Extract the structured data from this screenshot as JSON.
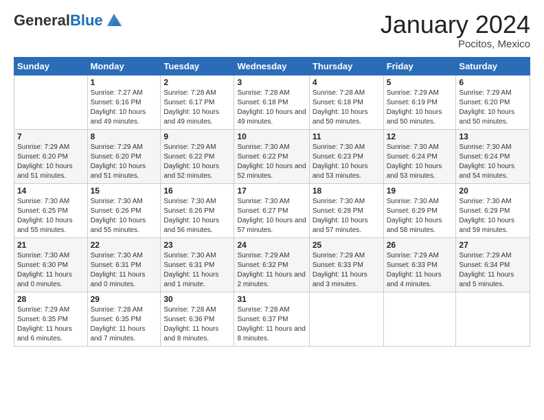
{
  "header": {
    "logo_general": "General",
    "logo_blue": "Blue",
    "month_title": "January 2024",
    "location": "Pocitos, Mexico"
  },
  "weekdays": [
    "Sunday",
    "Monday",
    "Tuesday",
    "Wednesday",
    "Thursday",
    "Friday",
    "Saturday"
  ],
  "weeks": [
    [
      {
        "day": "",
        "sunrise": "",
        "sunset": "",
        "daylight": ""
      },
      {
        "day": "1",
        "sunrise": "Sunrise: 7:27 AM",
        "sunset": "Sunset: 6:16 PM",
        "daylight": "Daylight: 10 hours and 49 minutes."
      },
      {
        "day": "2",
        "sunrise": "Sunrise: 7:28 AM",
        "sunset": "Sunset: 6:17 PM",
        "daylight": "Daylight: 10 hours and 49 minutes."
      },
      {
        "day": "3",
        "sunrise": "Sunrise: 7:28 AM",
        "sunset": "Sunset: 6:18 PM",
        "daylight": "Daylight: 10 hours and 49 minutes."
      },
      {
        "day": "4",
        "sunrise": "Sunrise: 7:28 AM",
        "sunset": "Sunset: 6:18 PM",
        "daylight": "Daylight: 10 hours and 50 minutes."
      },
      {
        "day": "5",
        "sunrise": "Sunrise: 7:29 AM",
        "sunset": "Sunset: 6:19 PM",
        "daylight": "Daylight: 10 hours and 50 minutes."
      },
      {
        "day": "6",
        "sunrise": "Sunrise: 7:29 AM",
        "sunset": "Sunset: 6:20 PM",
        "daylight": "Daylight: 10 hours and 50 minutes."
      }
    ],
    [
      {
        "day": "7",
        "sunrise": "Sunrise: 7:29 AM",
        "sunset": "Sunset: 6:20 PM",
        "daylight": "Daylight: 10 hours and 51 minutes."
      },
      {
        "day": "8",
        "sunrise": "Sunrise: 7:29 AM",
        "sunset": "Sunset: 6:20 PM",
        "daylight": "Daylight: 10 hours and 51 minutes."
      },
      {
        "day": "9",
        "sunrise": "Sunrise: 7:29 AM",
        "sunset": "Sunset: 6:22 PM",
        "daylight": "Daylight: 10 hours and 52 minutes."
      },
      {
        "day": "10",
        "sunrise": "Sunrise: 7:30 AM",
        "sunset": "Sunset: 6:22 PM",
        "daylight": "Daylight: 10 hours and 52 minutes."
      },
      {
        "day": "11",
        "sunrise": "Sunrise: 7:30 AM",
        "sunset": "Sunset: 6:23 PM",
        "daylight": "Daylight: 10 hours and 53 minutes."
      },
      {
        "day": "12",
        "sunrise": "Sunrise: 7:30 AM",
        "sunset": "Sunset: 6:24 PM",
        "daylight": "Daylight: 10 hours and 53 minutes."
      },
      {
        "day": "13",
        "sunrise": "Sunrise: 7:30 AM",
        "sunset": "Sunset: 6:24 PM",
        "daylight": "Daylight: 10 hours and 54 minutes."
      }
    ],
    [
      {
        "day": "14",
        "sunrise": "Sunrise: 7:30 AM",
        "sunset": "Sunset: 6:25 PM",
        "daylight": "Daylight: 10 hours and 55 minutes."
      },
      {
        "day": "15",
        "sunrise": "Sunrise: 7:30 AM",
        "sunset": "Sunset: 6:26 PM",
        "daylight": "Daylight: 10 hours and 55 minutes."
      },
      {
        "day": "16",
        "sunrise": "Sunrise: 7:30 AM",
        "sunset": "Sunset: 6:26 PM",
        "daylight": "Daylight: 10 hours and 56 minutes."
      },
      {
        "day": "17",
        "sunrise": "Sunrise: 7:30 AM",
        "sunset": "Sunset: 6:27 PM",
        "daylight": "Daylight: 10 hours and 57 minutes."
      },
      {
        "day": "18",
        "sunrise": "Sunrise: 7:30 AM",
        "sunset": "Sunset: 6:28 PM",
        "daylight": "Daylight: 10 hours and 57 minutes."
      },
      {
        "day": "19",
        "sunrise": "Sunrise: 7:30 AM",
        "sunset": "Sunset: 6:29 PM",
        "daylight": "Daylight: 10 hours and 58 minutes."
      },
      {
        "day": "20",
        "sunrise": "Sunrise: 7:30 AM",
        "sunset": "Sunset: 6:29 PM",
        "daylight": "Daylight: 10 hours and 59 minutes."
      }
    ],
    [
      {
        "day": "21",
        "sunrise": "Sunrise: 7:30 AM",
        "sunset": "Sunset: 6:30 PM",
        "daylight": "Daylight: 11 hours and 0 minutes."
      },
      {
        "day": "22",
        "sunrise": "Sunrise: 7:30 AM",
        "sunset": "Sunset: 6:31 PM",
        "daylight": "Daylight: 11 hours and 0 minutes."
      },
      {
        "day": "23",
        "sunrise": "Sunrise: 7:30 AM",
        "sunset": "Sunset: 6:31 PM",
        "daylight": "Daylight: 11 hours and 1 minute."
      },
      {
        "day": "24",
        "sunrise": "Sunrise: 7:29 AM",
        "sunset": "Sunset: 6:32 PM",
        "daylight": "Daylight: 11 hours and 2 minutes."
      },
      {
        "day": "25",
        "sunrise": "Sunrise: 7:29 AM",
        "sunset": "Sunset: 6:33 PM",
        "daylight": "Daylight: 11 hours and 3 minutes."
      },
      {
        "day": "26",
        "sunrise": "Sunrise: 7:29 AM",
        "sunset": "Sunset: 6:33 PM",
        "daylight": "Daylight: 11 hours and 4 minutes."
      },
      {
        "day": "27",
        "sunrise": "Sunrise: 7:29 AM",
        "sunset": "Sunset: 6:34 PM",
        "daylight": "Daylight: 11 hours and 5 minutes."
      }
    ],
    [
      {
        "day": "28",
        "sunrise": "Sunrise: 7:29 AM",
        "sunset": "Sunset: 6:35 PM",
        "daylight": "Daylight: 11 hours and 6 minutes."
      },
      {
        "day": "29",
        "sunrise": "Sunrise: 7:28 AM",
        "sunset": "Sunset: 6:35 PM",
        "daylight": "Daylight: 11 hours and 7 minutes."
      },
      {
        "day": "30",
        "sunrise": "Sunrise: 7:28 AM",
        "sunset": "Sunset: 6:36 PM",
        "daylight": "Daylight: 11 hours and 8 minutes."
      },
      {
        "day": "31",
        "sunrise": "Sunrise: 7:28 AM",
        "sunset": "Sunset: 6:37 PM",
        "daylight": "Daylight: 11 hours and 8 minutes."
      },
      {
        "day": "",
        "sunrise": "",
        "sunset": "",
        "daylight": ""
      },
      {
        "day": "",
        "sunrise": "",
        "sunset": "",
        "daylight": ""
      },
      {
        "day": "",
        "sunrise": "",
        "sunset": "",
        "daylight": ""
      }
    ]
  ]
}
